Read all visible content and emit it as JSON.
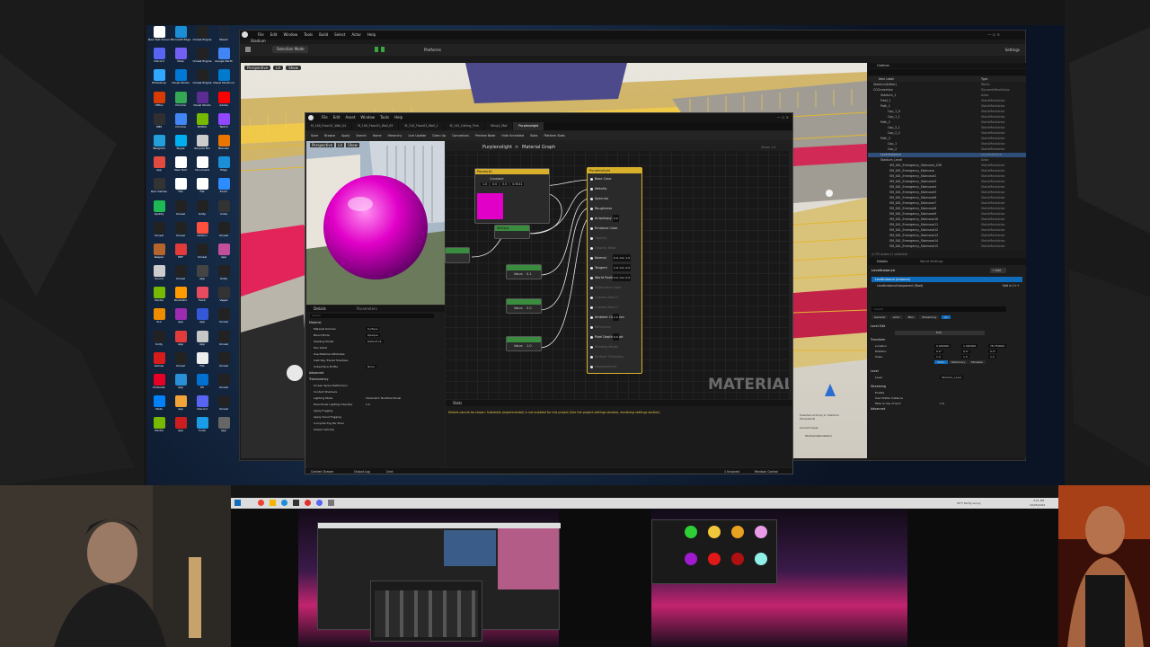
{
  "colors": {
    "accent_blue": "#0f6cbd",
    "magenta": "#e100c8",
    "node_gold": "#d8b02c",
    "sunset_pink": "#c2246e",
    "sunset_purple": "#3b1a4a"
  },
  "desktop": {
    "icons": [
      {
        "label": "New Text Document",
        "color": "#fff"
      },
      {
        "label": "Microsoft Edge",
        "color": "#1a8fd6"
      },
      {
        "label": "Unreal Engine",
        "color": "#222"
      },
      {
        "label": "Steam",
        "color": "#1b2838"
      },
      {
        "label": "Discord",
        "color": "#5865f2"
      },
      {
        "label": "Viber",
        "color": "#7360f2"
      },
      {
        "label": "Unreal Engine",
        "color": "#222"
      },
      {
        "label": "Google Earth",
        "color": "#4285f4"
      },
      {
        "label": "Photoshop",
        "color": "#31a8ff"
      },
      {
        "label": "Visual Studio",
        "color": "#0078d4"
      },
      {
        "label": "Unreal Engine",
        "color": "#222"
      },
      {
        "label": "Visual Studio Code",
        "color": "#007acc"
      },
      {
        "label": "Office",
        "color": "#d83b01"
      },
      {
        "label": "Chrome",
        "color": "#34a853"
      },
      {
        "label": "Visual Studio",
        "color": "#5c2d91"
      },
      {
        "label": "Adobe",
        "color": "#ff0000"
      },
      {
        "label": "OBS",
        "color": "#302e31"
      },
      {
        "label": "Chrome",
        "color": "#4285f4"
      },
      {
        "label": "NVIDIA",
        "color": "#76b900"
      },
      {
        "label": "Twitch",
        "color": "#9146ff"
      },
      {
        "label": "Telegram",
        "color": "#229ed9"
      },
      {
        "label": "Skype",
        "color": "#00aff0"
      },
      {
        "label": "Recycle Bin",
        "color": "#ccc"
      },
      {
        "label": "Blender",
        "color": "#ea7600"
      },
      {
        "label": "App",
        "color": "#e04a3f"
      },
      {
        "label": "New Text",
        "color": "#fff"
      },
      {
        "label": "Document",
        "color": "#fff"
      },
      {
        "label": "Edge",
        "color": "#1a8fd6"
      },
      {
        "label": "Epic Games",
        "color": "#333"
      },
      {
        "label": "File",
        "color": "#fff"
      },
      {
        "label": "File",
        "color": "#fff"
      },
      {
        "label": "Zoom",
        "color": "#2d8cff"
      },
      {
        "label": "Spotify",
        "color": "#1db954"
      },
      {
        "label": "Unreal",
        "color": "#222"
      },
      {
        "label": "Unity",
        "color": "#222"
      },
      {
        "label": "Code",
        "color": "#333"
      },
      {
        "label": "Unreal",
        "color": "#222"
      },
      {
        "label": "Unreal",
        "color": "#222"
      },
      {
        "label": "DaVinci",
        "color": "#ff4f3e"
      },
      {
        "label": "Unreal",
        "color": "#222"
      },
      {
        "label": "Reaper",
        "color": "#b5652b"
      },
      {
        "label": "PDF",
        "color": "#e23b3b"
      },
      {
        "label": "Unreal",
        "color": "#222"
      },
      {
        "label": "App",
        "color": "#c24f9a"
      },
      {
        "label": "Sound",
        "color": "#ccc"
      },
      {
        "label": "Unreal",
        "color": "#222"
      },
      {
        "label": "App",
        "color": "#444"
      },
      {
        "label": "Unity",
        "color": "#222"
      },
      {
        "label": "Nvidia",
        "color": "#76b900"
      },
      {
        "label": "Illustrator",
        "color": "#ff9a00"
      },
      {
        "label": "Paint",
        "color": "#e84a5f"
      },
      {
        "label": "Vegas",
        "color": "#333"
      },
      {
        "label": "VLC",
        "color": "#f08c00"
      },
      {
        "label": "App",
        "color": "#9c2cb0"
      },
      {
        "label": "App",
        "color": "#3558d8"
      },
      {
        "label": "Unreal",
        "color": "#222"
      },
      {
        "label": "Unity",
        "color": "#222"
      },
      {
        "label": "App",
        "color": "#e23b3b"
      },
      {
        "label": "App",
        "color": "#c7c7c7"
      },
      {
        "label": "Unreal",
        "color": "#222"
      },
      {
        "label": "Games",
        "color": "#d81b1b"
      },
      {
        "label": "Unreal",
        "color": "#222"
      },
      {
        "label": "File",
        "color": "#eee"
      },
      {
        "label": "Unreal",
        "color": "#222"
      },
      {
        "label": "Pinterest",
        "color": "#e60023"
      },
      {
        "label": "App",
        "color": "#2a8fd6"
      },
      {
        "label": "PS",
        "color": "#0070d1"
      },
      {
        "label": "Unreal",
        "color": "#222"
      },
      {
        "label": "Meta",
        "color": "#0081fb"
      },
      {
        "label": "App",
        "color": "#f2a33a"
      },
      {
        "label": "Discord",
        "color": "#5865f2"
      },
      {
        "label": "Unreal",
        "color": "#222"
      },
      {
        "label": "Nvidia",
        "color": "#76b900"
      },
      {
        "label": "App",
        "color": "#cc1e1e"
      },
      {
        "label": "Code",
        "color": "#1a9de6"
      },
      {
        "label": "App",
        "color": "#666"
      }
    ]
  },
  "ue_main": {
    "menu": [
      "File",
      "Edit",
      "Window",
      "Tools",
      "Build",
      "Select",
      "Actor",
      "Help"
    ],
    "project": "Stadium",
    "selection_mode": "Selection Mode",
    "platforms": "Platforms",
    "settings": "Settings",
    "viewport_modes": [
      "Perspective",
      "Lit",
      "Show"
    ],
    "outliner": {
      "title": "Outliner",
      "col_item": "Item Label",
      "col_type": "Type",
      "rows": [
        {
          "label": "Stadium(Editor)",
          "type": "World"
        },
        {
          "label": "COOnnection",
          "type": "DynamicMeshActor"
        },
        {
          "label": "Stadium_1",
          "type": "Actor"
        },
        {
          "label": "Field_1",
          "type": "StaticMeshActor"
        },
        {
          "label": "Path_1",
          "type": "StaticMeshActor"
        },
        {
          "label": "Cap_1_0",
          "type": "StaticMeshActor"
        },
        {
          "label": "Cap_1_1",
          "type": "StaticMeshActor"
        },
        {
          "label": "Path_2",
          "type": "StaticMeshActor"
        },
        {
          "label": "Cap_2_1",
          "type": "StaticMeshActor"
        },
        {
          "label": "Cap_2_2",
          "type": "StaticMeshActor"
        },
        {
          "label": "Path_3",
          "type": "StaticMeshActor"
        },
        {
          "label": "Cap_1",
          "type": "StaticMeshActor"
        },
        {
          "label": "Cap_2",
          "type": "StaticMeshActor"
        },
        {
          "label": "LevelInstance",
          "type": "LevelInstance"
        },
        {
          "label": "Stadium_Level",
          "type": "Actor"
        },
        {
          "label": "SM_001_Emergency_Staircase_03R",
          "type": "StaticMeshActor"
        },
        {
          "label": "SM_001_Emergency_Staircase",
          "type": "StaticMeshActor"
        },
        {
          "label": "SM_001_Emergency_Staircase2",
          "type": "StaticMeshActor"
        },
        {
          "label": "SM_001_Emergency_Staircase3",
          "type": "StaticMeshActor"
        },
        {
          "label": "SM_001_Emergency_Staircase4",
          "type": "StaticMeshActor"
        },
        {
          "label": "SM_001_Emergency_Staircase5",
          "type": "StaticMeshActor"
        },
        {
          "label": "SM_001_Emergency_Staircase6",
          "type": "StaticMeshActor"
        },
        {
          "label": "SM_001_Emergency_Staircase7",
          "type": "StaticMeshActor"
        },
        {
          "label": "SM_001_Emergency_Staircase8",
          "type": "StaticMeshActor"
        },
        {
          "label": "SM_001_Emergency_Staircase9",
          "type": "StaticMeshActor"
        },
        {
          "label": "SM_001_Emergency_Staircase10",
          "type": "StaticMeshActor"
        },
        {
          "label": "SM_001_Emergency_Staircase11",
          "type": "StaticMeshActor"
        },
        {
          "label": "SM_001_Emergency_Staircase12",
          "type": "StaticMeshActor"
        },
        {
          "label": "SM_001_Emergency_Staircase13",
          "type": "StaticMeshActor"
        },
        {
          "label": "SM_001_Emergency_Staircase14",
          "type": "StaticMeshActor"
        },
        {
          "label": "SM_001_Emergency_Staircase15",
          "type": "StaticMeshActor"
        }
      ],
      "footer": "4,733 actors (1 selected)"
    },
    "details": {
      "tab_details": "Details",
      "tab_world": "World Settings",
      "actor_name": "LevelInstance",
      "component": "LevelInstance (Instance)",
      "component2": "LevelInstanceComponent (Root)",
      "edit_link": "Edit in C++",
      "add": "+ Add",
      "search": "Search",
      "filter_tabs": [
        "General",
        "Actor",
        "Misc",
        "Streaming",
        "All"
      ],
      "sections": [
        "Level Edit",
        "Transform",
        "Level",
        "Streaming",
        "Advanced"
      ],
      "edit_btn": "Edit",
      "transform": [
        {
          "label": "Location",
          "x": "0.000000",
          "y": "1.000000",
          "z": "78.750000"
        },
        {
          "label": "Rotation",
          "x": "0.0°",
          "y": "0.0°",
          "z": "0.0°"
        },
        {
          "label": "Scale",
          "x": "1.0",
          "y": "1.0",
          "z": "1.0"
        }
      ],
      "mobility": [
        "Static",
        "Stationary",
        "Movable"
      ],
      "level_label": "Level",
      "level_value": "Stadium_Level",
      "streaming": [
        {
          "label": "Enable",
          "value": ""
        },
        {
          "label": "Use Hidden Instance",
          "value": ""
        },
        {
          "label": "Filter & Use of Grid",
          "value": "1.0"
        }
      ]
    },
    "status_left": "Content Drawer",
    "status_mid": "Output Log",
    "status_cmd": "Cmd",
    "status_right": "1 Unsaved",
    "status_rc": "Revision Control",
    "viewport_label": "Selected Actor(s) in: Stadium (Persistent)",
    "current_level": "Current Level:",
    "current_level_val": "Stadium(Persistent)"
  },
  "mat_editor": {
    "tabs": [
      "M_100_Floor01_Wall_04",
      "M_100_Floor01_Wall_05",
      "M_110_Floor03_Wall_1",
      "M_142_Ceiling_Trim",
      "Sting1_Mat",
      "Purplenolight"
    ],
    "menu": [
      "File",
      "Edit",
      "Asset",
      "Window",
      "Tools",
      "Help"
    ],
    "toolbar": [
      "Save",
      "Browse",
      "Apply",
      "Search",
      "Home",
      "Hierarchy",
      "Live Update",
      "Clean Up",
      "Connectors",
      "Preview Node",
      "Hide Unrelated",
      "Stats",
      "Platform Stats"
    ],
    "viewport_tabs": [
      "Perspective",
      "Lit",
      "Show"
    ],
    "breadcrumb_asset": "Purplenolight",
    "breadcrumb_sep": ">",
    "breadcrumb_graph": "Material Graph",
    "zoom": "Zoom 1:1",
    "watermark": "MATERIAL",
    "details_tab": "Details",
    "params_tab": "Parameters",
    "details_search": "Search",
    "details_section": "Material",
    "details_rows": [
      {
        "label": "Material Domain",
        "value": "Surface"
      },
      {
        "label": "Blend Mode",
        "value": "Opaque"
      },
      {
        "label": "Shading Model",
        "value": "Default Lit"
      },
      {
        "label": "Two Sided",
        "value": ""
      },
      {
        "label": "Use Material Attributes",
        "value": ""
      },
      {
        "label": "Cast Ray Traced Shadows",
        "value": ""
      },
      {
        "label": "Subsurface Profile",
        "value": "None"
      }
    ],
    "details_section2": "Advanced",
    "details_section3": "Translucency",
    "details_rows2": [
      {
        "label": "Screen Space Reflections",
        "value": ""
      },
      {
        "label": "Contact Shadows",
        "value": ""
      },
      {
        "label": "Lighting Mode",
        "value": "Volumetric NonDirectional"
      },
      {
        "label": "Directional Lighting Intensity",
        "value": "1.0"
      },
      {
        "label": "Apply Fogging",
        "value": ""
      },
      {
        "label": "Apply Cloud Fogging",
        "value": ""
      },
      {
        "label": "Compute Fog Per Pixel",
        "value": ""
      },
      {
        "label": "Output Velocity",
        "value": ""
      }
    ],
    "stats_tab": "Stats",
    "stats_message": "Details cannot be shown: Substrate (experimental) is not enabled for this project (See the project settings window, rendering settings section)",
    "bottom": [
      "Content Drawer",
      "Output Log",
      "Cmd"
    ],
    "bottom_right": [
      "1 Unsaved",
      "Revision Control"
    ],
    "nodes": {
      "constant_header": "Param(#)",
      "constant_label": "Constant",
      "constant_values": [
        "1.0",
        "0.0",
        "0.0",
        "0.5041"
      ],
      "multiply": "Multiply",
      "value1": "Value",
      "value1_v": "0.1",
      "value2": "Value",
      "value2_v": "0.0",
      "value3": "Value",
      "value3_v": "1.0",
      "value4": "Value",
      "value4_v": "1.0",
      "output_header": "Purplenolight",
      "output_pins": [
        "Base Color",
        "Metallic",
        "Specular",
        "Roughness",
        "Anisotropy",
        "Emissive Color",
        "Opacity",
        "Opacity Mask",
        "Normal",
        "Tangent",
        "World Position Offset",
        "Subsurface Color",
        "Custom Data 0",
        "Custom Data 1",
        "Ambient Occlusion",
        "Refraction",
        "Pixel Depth Offset",
        "Shading Model",
        "Surface Thickness",
        "Displacement"
      ],
      "pin_values": {
        "Anisotropy": "0.0",
        "Normal": "0.0, 0.0, 1.0",
        "Tangent": "1.0, 0.0, 0.0",
        "World Position Offset": "0.0, 0.0, 0.0",
        "Ambient Occlusion": "1.0",
        "Pixel Depth Offset": "0.0"
      }
    }
  },
  "taskbar": {
    "weather": "95°F Partly sunny",
    "time": "3:21 PM",
    "date": "10/25/2024"
  }
}
